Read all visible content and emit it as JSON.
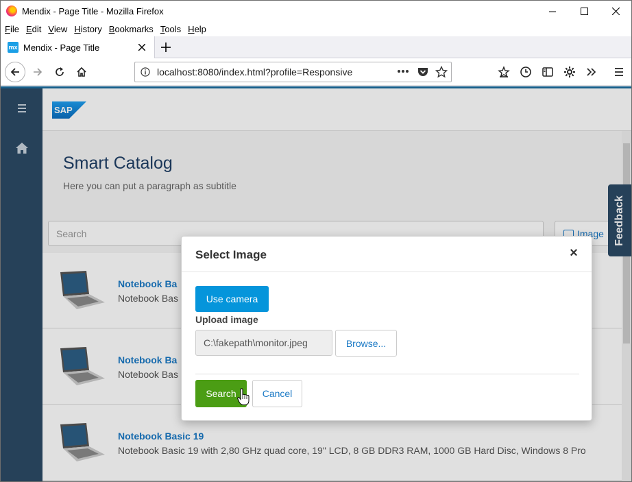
{
  "window": {
    "title": "Mendix - Page Title - Mozilla Firefox"
  },
  "menubar": {
    "items": [
      {
        "key": "F",
        "rest": "ile"
      },
      {
        "key": "E",
        "rest": "dit"
      },
      {
        "key": "V",
        "rest": "iew"
      },
      {
        "key": "H",
        "rest": "istory",
        "pre": ""
      },
      {
        "key": "B",
        "rest": "ookmarks"
      },
      {
        "key": "T",
        "rest": "ools"
      },
      {
        "key": "H",
        "rest": "elp"
      }
    ]
  },
  "tab": {
    "favicon": "mx",
    "label": "Mendix - Page Title"
  },
  "urlbar": {
    "url": "localhost:8080/index.html?profile=Responsive"
  },
  "header": {
    "logo": "SAP"
  },
  "page": {
    "title": "Smart Catalog",
    "subtitle": "Here you can put a paragraph as subtitle",
    "search_placeholder": "Search",
    "image_button": "Image",
    "feedback": "Feedback"
  },
  "products": [
    {
      "name": "Notebook Ba",
      "desc": "Notebook Bas"
    },
    {
      "name": "Notebook Ba",
      "desc": "Notebook Bas"
    },
    {
      "name": "Notebook Basic 19",
      "desc": "Notebook Basic 19 with 2,80 GHz quad core, 19\" LCD, 8 GB DDR3 RAM, 1000 GB Hard Disc, Windows 8 Pro"
    }
  ],
  "modal": {
    "title": "Select Image",
    "close": "×",
    "use_camera": "Use camera",
    "upload_label": "Upload image",
    "file_value": "C:\\fakepath\\monitor.jpeg",
    "browse": "Browse...",
    "search": "Search",
    "cancel": "Cancel"
  },
  "colors": {
    "sidebar": "#2c4a66",
    "primary": "#0595db",
    "success": "#4b9d14",
    "link": "#1a79c5",
    "title": "#1f3f66"
  }
}
